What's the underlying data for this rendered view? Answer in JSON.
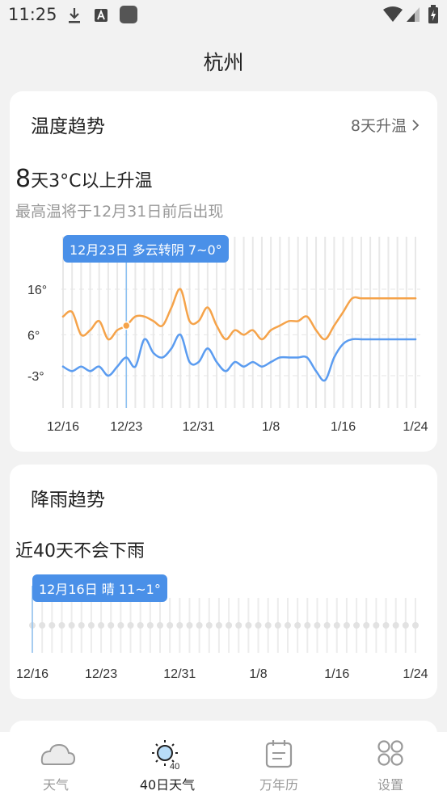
{
  "status_bar": {
    "time": "11:25",
    "icons": [
      "download-icon",
      "a-notification-icon",
      "app-notification-icon",
      "wifi-icon",
      "signal-icon",
      "battery-icon"
    ]
  },
  "city": "杭州",
  "temperature_trend": {
    "title": "温度趋势",
    "action_label": "8天升温",
    "headline_number": "8",
    "headline_text": "天3°C以上升温",
    "subtitle": "最高温将于12月31日前后出现",
    "tooltip": "12月23日 多云转阴 7~0°",
    "chart_data": {
      "type": "line",
      "y_tick_labels": [
        "16°",
        "6°",
        "-3°"
      ],
      "y_ticks": [
        16,
        6,
        -3
      ],
      "x_tick_labels": [
        "12/16",
        "12/23",
        "12/31",
        "1/8",
        "1/16",
        "1/24"
      ],
      "x_ticks": [
        0,
        7,
        15,
        23,
        31,
        39
      ],
      "ylim": [
        -8,
        22
      ],
      "selected_day": 7,
      "series": [
        {
          "color": "#f5a34a",
          "values": [
            10,
            11,
            6,
            7,
            9,
            5,
            7,
            8,
            10,
            10,
            9,
            8,
            12,
            16,
            9,
            9,
            12,
            8,
            5,
            7,
            6,
            7,
            5,
            7,
            8,
            9,
            9,
            10,
            7,
            5,
            8,
            11,
            14,
            14,
            14,
            14,
            14,
            14,
            14,
            14
          ]
        },
        {
          "color": "#5b9cf0",
          "values": [
            -1,
            -2,
            -1,
            -2,
            -1,
            -3,
            -1,
            1,
            -1,
            5,
            2,
            1,
            3,
            6,
            0,
            0,
            3,
            0,
            -2,
            0,
            -1,
            0,
            -1,
            0,
            1,
            1,
            1,
            1,
            -2,
            -4,
            1,
            4,
            5,
            5,
            5,
            5,
            5,
            5,
            5,
            5
          ]
        }
      ]
    }
  },
  "rain_trend": {
    "title": "降雨趋势",
    "headline": "近40天不会下雨",
    "tooltip": "12月16日 晴 11~1°",
    "chart_data": {
      "type": "scatter",
      "x_tick_labels": [
        "12/16",
        "12/23",
        "12/31",
        "1/8",
        "1/16",
        "1/24"
      ],
      "x_ticks": [
        0,
        7,
        15,
        23,
        31,
        39
      ],
      "points": 40,
      "precipitation": 0,
      "selected_day": 0
    }
  },
  "tabbar": {
    "tabs": [
      {
        "label": "天气",
        "icon": "cloud-icon",
        "active": false
      },
      {
        "label": "40日天气",
        "icon": "sun-40-icon",
        "active": true
      },
      {
        "label": "万年历",
        "icon": "calendar-icon",
        "active": false
      },
      {
        "label": "设置",
        "icon": "settings-grid-icon",
        "active": false
      }
    ]
  },
  "colors": {
    "accent": "#4a90e8",
    "high_temp": "#f5a34a",
    "low_temp": "#5b9cf0",
    "background": "#f2f2f2"
  }
}
